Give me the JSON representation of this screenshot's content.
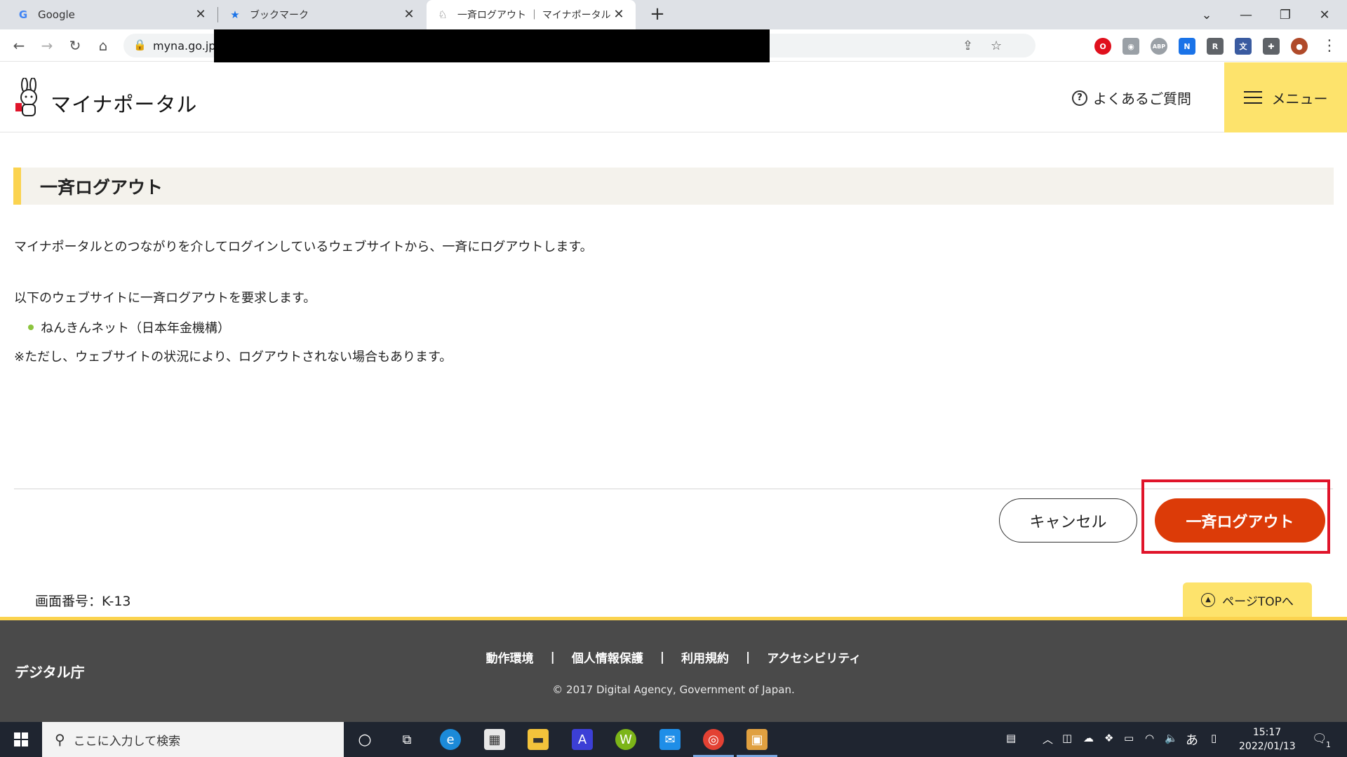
{
  "browser": {
    "tabs": [
      {
        "title": "Google",
        "icon": "google-g-icon"
      },
      {
        "title": "ブックマーク",
        "icon": "star-icon"
      },
      {
        "title": "一斉ログアウト ｜ マイナポータル",
        "icon": "mynaportal-icon"
      }
    ],
    "url": "myna.go.jp/"
  },
  "header": {
    "logo_text": "マイナポータル",
    "faq_label": "よくあるご質問",
    "menu_label": "メニュー"
  },
  "main": {
    "title": "一斉ログアウト",
    "description": "マイナポータルとのつながりを介してログインしているウェブサイトから、一斉にログアウトします。",
    "request_text": "以下のウェブサイトに一斉ログアウトを要求します。",
    "websites": [
      "ねんきんネット（日本年金機構）"
    ],
    "note": "※ただし、ウェブサイトの状況により、ログアウトされない場合もあります。",
    "cancel_label": "キャンセル",
    "logout_label": "一斉ログアウト",
    "screen_number": "画面番号：K-13",
    "page_top_label": "ページTOPへ"
  },
  "footer": {
    "org": "デジタル庁",
    "links": [
      "動作環境",
      "個人情報保護",
      "利用規約",
      "アクセシビリティ"
    ],
    "separator": "|",
    "copyright": "© 2017 Digital Agency, Government of Japan."
  },
  "taskbar": {
    "search_placeholder": "ここに入力して検索",
    "ime": "あ",
    "time": "15:17",
    "date": "2022/01/13",
    "notification_count": "1"
  },
  "colors": {
    "accent_yellow": "#fde36c",
    "title_bar_yellow": "#fbd34f",
    "logout_red": "#dc3b08",
    "highlight_red": "#e0142a",
    "bullet_green": "#8cc43d",
    "footer_gray": "#4a4a4a"
  }
}
